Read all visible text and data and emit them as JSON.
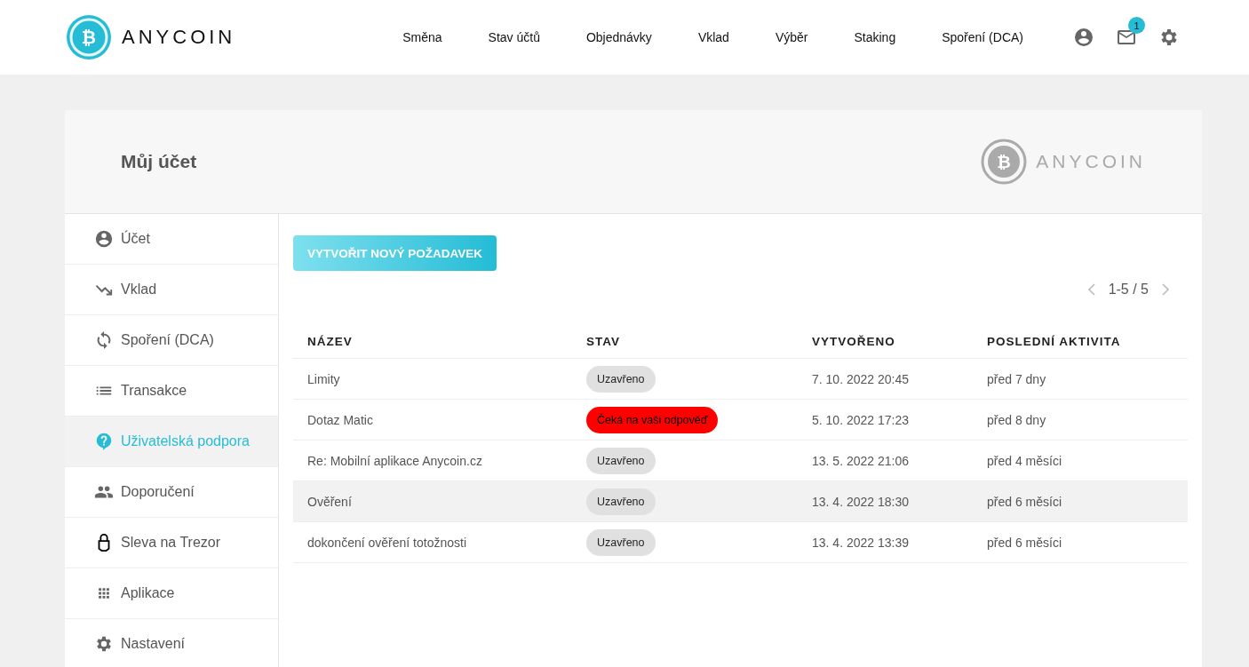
{
  "header": {
    "logo_symbol": "₿",
    "logo": "ANY**COIN**",
    "nav": [
      "Směna",
      "Stav účtů",
      "Objednávky",
      "Vklad",
      "Výběr",
      "Staking",
      "Spoření (DCA)"
    ],
    "mail_badge": "1"
  },
  "card": {
    "title": "Můj účet",
    "logo_symbol": "₿",
    "logo": "ANY**COIN**"
  },
  "sidebar": {
    "items": [
      {
        "label": "Účet",
        "selected": false
      },
      {
        "label": "Vklad",
        "selected": false
      },
      {
        "label": "Spoření (DCA)",
        "selected": false
      },
      {
        "label": "Transakce",
        "selected": false
      },
      {
        "label": "Uživatelská podpora",
        "selected": true
      },
      {
        "label": "Doporučení",
        "selected": false
      },
      {
        "label": "Sleva na Trezor",
        "selected": false
      },
      {
        "label": "Aplikace",
        "selected": false
      },
      {
        "label": "Nastavení",
        "selected": false
      }
    ]
  },
  "new_request_button": "VYTVOŘIT NOVÝ POŽADAVEK",
  "pagination": "1-5 / 5",
  "table": {
    "columns": [
      "NÁZEV",
      "STAV",
      "VYTVOŘENO",
      "POSLEDNÍ AKTIVITA"
    ],
    "rows": [
      {
        "name": "Limity",
        "status": "Uzavřeno",
        "kind": "closed",
        "created": "7. 10. 2022 20:45",
        "activity": "před 7 dny",
        "selected": false
      },
      {
        "name": "Dotaz Matic",
        "status": "Čeká na vaši odpověď",
        "kind": "waiting",
        "created": "5. 10. 2022 17:23",
        "activity": "před 8 dny",
        "selected": false
      },
      {
        "name": "Re: Mobilní aplikace Anycoin.cz",
        "status": "Uzavřeno",
        "kind": "closed",
        "created": "13. 5. 2022 21:06",
        "activity": "před 4 měsíci",
        "selected": false
      },
      {
        "name": "Ověření",
        "status": "Uzavřeno",
        "kind": "closed",
        "created": "13. 4. 2022 18:30",
        "activity": "před 6 měsíci",
        "selected": true
      },
      {
        "name": "dokončení ověření totožnosti",
        "status": "Uzavřeno",
        "kind": "closed",
        "created": "13. 4. 2022 13:39",
        "activity": "před 6 měsíci",
        "selected": false
      }
    ]
  }
}
